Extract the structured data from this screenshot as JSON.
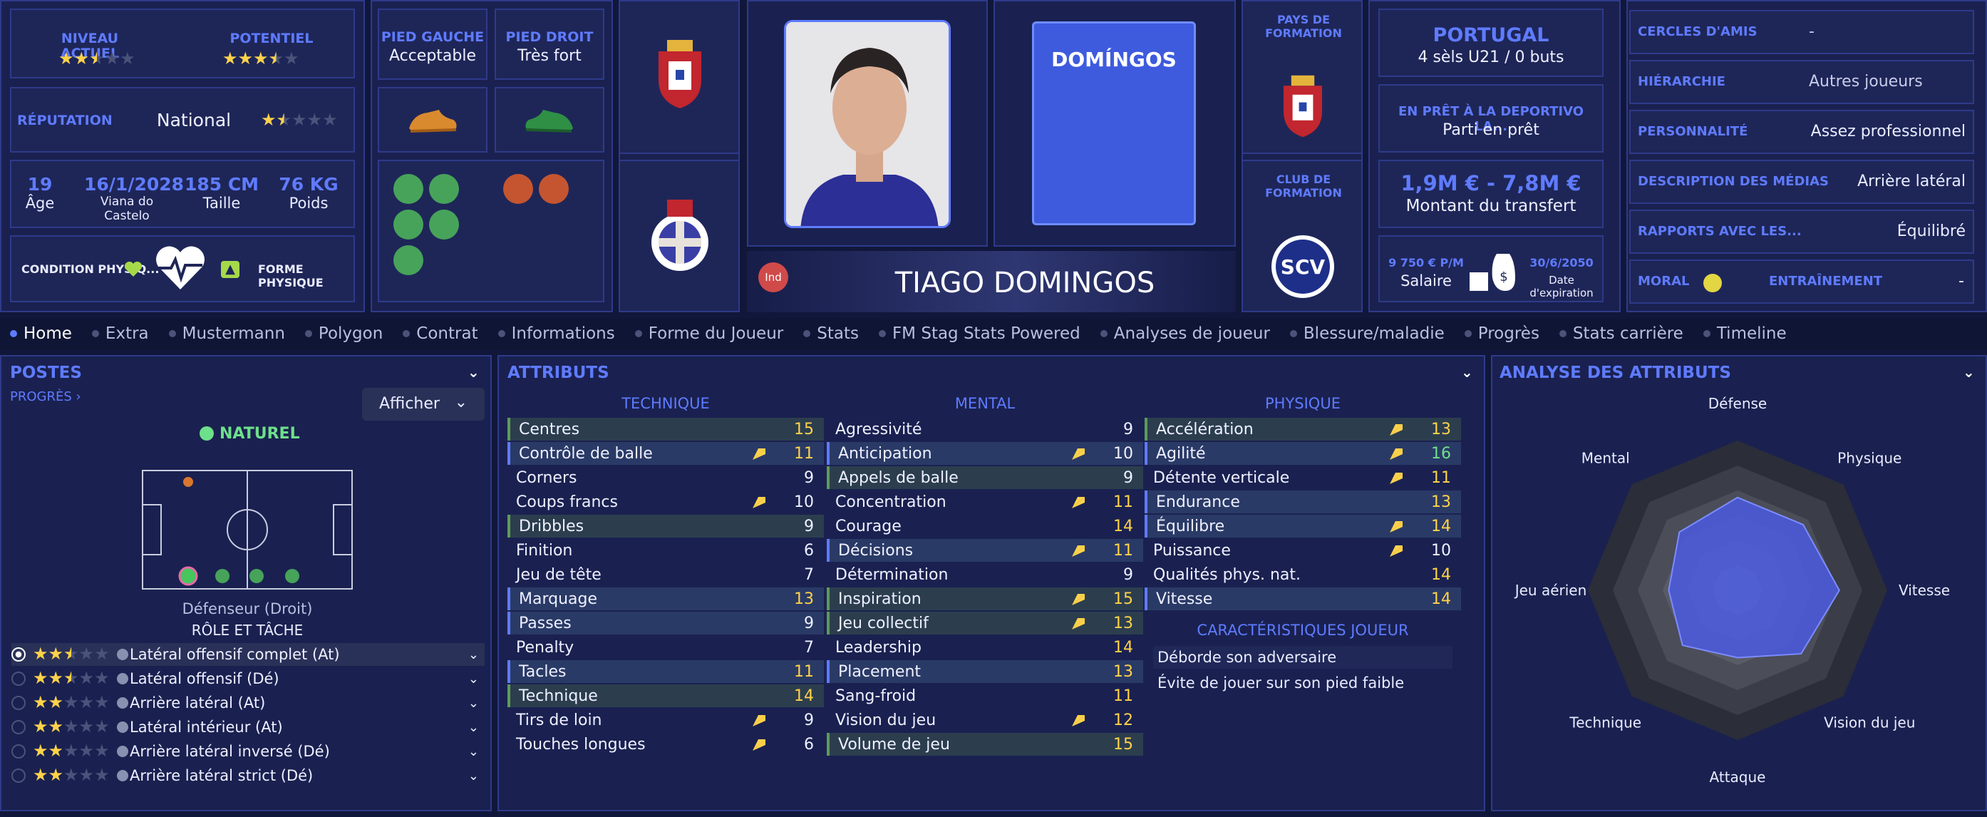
{
  "colors": {
    "accent": "#5f7bff",
    "star": "#ffd24a",
    "good": "#6de08a",
    "bg": "#11173a"
  },
  "top": {
    "current_level_label": "NIVEAU ACTUEL",
    "current_level_stars": 2.5,
    "potential_label": "POTENTIEL",
    "potential_stars": 3.5,
    "reputation_label": "RÉPUTATION",
    "reputation_value": "National",
    "reputation_stars": 1.5,
    "age": "19",
    "age_label": "Âge",
    "dob": "16/1/2028",
    "birthplace": "Viana do Castelo",
    "height": "185 CM",
    "height_label": "Taille",
    "weight": "76 KG",
    "weight_label": "Poids",
    "condition_label": "CONDITION PHYSIQ...",
    "form_label": "FORME PHYSIQUE",
    "left_foot_label": "PIED GAUCHE",
    "left_foot_value": "Acceptable",
    "right_foot_label": "PIED DROIT",
    "right_foot_value": "Très fort",
    "kit_name": "DOMÍNGOS",
    "player_name": "TIAGO DOMINGOS",
    "badge": "Ind",
    "nation_label": "PAYS DE FORMATION",
    "club_label": "CLUB DE FORMATION",
    "country": "PORTUGAL",
    "caps": "4 sèls U21 / 0 buts",
    "loan_label": "EN PRÊT À LA DEPORTIVO LA...",
    "loan_value": "Parti en prêt",
    "transfer_value": "1,9M € - 7,8M €",
    "transfer_label": "Montant du transfert",
    "salary": "9 750 € P/M",
    "salary_label": "Salaire",
    "expiry": "30/6/2050",
    "expiry_label": "Date d'expiration",
    "friends_label": "CERCLES D'AMIS",
    "friends_value": "-",
    "hierarchy_label": "HIÉRARCHIE",
    "hierarchy_value": "Autres joueurs",
    "personality_label": "PERSONNALITÉ",
    "personality_value": "Assez professionnel",
    "media_label": "DESCRIPTION DES MÉDIAS",
    "media_value": "Arrière latéral",
    "relations_label": "RAPPORTS AVEC LES...",
    "relations_value": "Équilibré",
    "morale_label": "MORAL",
    "training_label": "ENTRAÎNEMENT",
    "training_value": "-"
  },
  "tabs": [
    "Home",
    "Extra",
    "Mustermann",
    "Polygon",
    "Contrat",
    "Informations",
    "Forme du Joueur",
    "Stats",
    "FM Stag Stats Powered",
    "Analyses de joueur",
    "Blessure/maladie",
    "Progrès",
    "Stats carrière",
    "Timeline"
  ],
  "positions": {
    "title": "POSTES",
    "progress_link": "PROGRÈS",
    "show_button": "Afficher",
    "natural": "NATUREL",
    "position_name": "Défenseur (Droit)",
    "role_header": "RÔLE ET TÂCHE",
    "roles": [
      {
        "name": "Latéral offensif complet (At)",
        "stars": 2.5
      },
      {
        "name": "Latéral offensif (Dé)",
        "stars": 2.5
      },
      {
        "name": "Arrière latéral (At)",
        "stars": 2
      },
      {
        "name": "Latéral intérieur (At)",
        "stars": 2
      },
      {
        "name": "Arrière latéral inversé (Dé)",
        "stars": 2
      },
      {
        "name": "Arrière latéral strict (Dé)",
        "stars": 2
      }
    ]
  },
  "attributes": {
    "title": "ATTRIBUTS",
    "technical_header": "TECHNIQUE",
    "mental_header": "MENTAL",
    "physical_header": "PHYSIQUE",
    "technical": [
      {
        "name": "Centres",
        "value": "15",
        "hl": "g",
        "trend": false,
        "col": "y"
      },
      {
        "name": "Contrôle de balle",
        "value": "11",
        "hl": "b",
        "trend": true,
        "col": "y"
      },
      {
        "name": "Corners",
        "value": "9",
        "hl": "",
        "trend": false,
        "col": "w"
      },
      {
        "name": "Coups francs",
        "value": "10",
        "hl": "",
        "trend": true,
        "col": "w"
      },
      {
        "name": "Dribbles",
        "value": "9",
        "hl": "g",
        "trend": false,
        "col": "w"
      },
      {
        "name": "Finition",
        "value": "6",
        "hl": "",
        "trend": false,
        "col": "w"
      },
      {
        "name": "Jeu de tête",
        "value": "7",
        "hl": "",
        "trend": false,
        "col": "w"
      },
      {
        "name": "Marquage",
        "value": "13",
        "hl": "b",
        "trend": false,
        "col": "y"
      },
      {
        "name": "Passes",
        "value": "9",
        "hl": "b",
        "trend": false,
        "col": "w"
      },
      {
        "name": "Penalty",
        "value": "7",
        "hl": "",
        "trend": false,
        "col": "w"
      },
      {
        "name": "Tacles",
        "value": "11",
        "hl": "b",
        "trend": false,
        "col": "y"
      },
      {
        "name": "Technique",
        "value": "14",
        "hl": "g",
        "trend": false,
        "col": "y"
      },
      {
        "name": "Tirs de loin",
        "value": "9",
        "hl": "",
        "trend": true,
        "col": "w"
      },
      {
        "name": "Touches longues",
        "value": "6",
        "hl": "",
        "trend": true,
        "col": "w"
      }
    ],
    "mental": [
      {
        "name": "Agressivité",
        "value": "9",
        "hl": "",
        "trend": false,
        "col": "w"
      },
      {
        "name": "Anticipation",
        "value": "10",
        "hl": "b",
        "trend": true,
        "col": "w"
      },
      {
        "name": "Appels de balle",
        "value": "9",
        "hl": "g",
        "trend": false,
        "col": "w"
      },
      {
        "name": "Concentration",
        "value": "11",
        "hl": "",
        "trend": true,
        "col": "y"
      },
      {
        "name": "Courage",
        "value": "14",
        "hl": "",
        "trend": false,
        "col": "y"
      },
      {
        "name": "Décisions",
        "value": "11",
        "hl": "b",
        "trend": true,
        "col": "y"
      },
      {
        "name": "Détermination",
        "value": "9",
        "hl": "",
        "trend": false,
        "col": "w"
      },
      {
        "name": "Inspiration",
        "value": "15",
        "hl": "g",
        "trend": true,
        "col": "y"
      },
      {
        "name": "Jeu collectif",
        "value": "13",
        "hl": "g",
        "trend": true,
        "col": "y"
      },
      {
        "name": "Leadership",
        "value": "14",
        "hl": "",
        "trend": false,
        "col": "y"
      },
      {
        "name": "Placement",
        "value": "13",
        "hl": "b",
        "trend": false,
        "col": "y"
      },
      {
        "name": "Sang-froid",
        "value": "11",
        "hl": "",
        "trend": false,
        "col": "y"
      },
      {
        "name": "Vision du jeu",
        "value": "12",
        "hl": "",
        "trend": true,
        "col": "y"
      },
      {
        "name": "Volume de jeu",
        "value": "15",
        "hl": "g",
        "trend": false,
        "col": "y"
      }
    ],
    "physical": [
      {
        "name": "Accélération",
        "value": "13",
        "hl": "g",
        "trend": true,
        "col": "y"
      },
      {
        "name": "Agilité",
        "value": "16",
        "hl": "b",
        "trend": true,
        "col": "g"
      },
      {
        "name": "Détente verticale",
        "value": "11",
        "hl": "",
        "trend": true,
        "col": "y"
      },
      {
        "name": "Endurance",
        "value": "13",
        "hl": "b",
        "trend": false,
        "col": "y"
      },
      {
        "name": "Équilibre",
        "value": "14",
        "hl": "b",
        "trend": true,
        "col": "y"
      },
      {
        "name": "Puissance",
        "value": "10",
        "hl": "",
        "trend": true,
        "col": "w"
      },
      {
        "name": "Qualités phys. nat.",
        "value": "14",
        "hl": "",
        "trend": false,
        "col": "y"
      },
      {
        "name": "Vitesse",
        "value": "14",
        "hl": "b",
        "trend": false,
        "col": "y"
      }
    ],
    "traits_header": "CARACTÉRISTIQUES JOUEUR",
    "traits": [
      "Déborde son adversaire",
      "Évite de jouer sur son pied faible"
    ]
  },
  "analysis": {
    "title": "ANALYSE DES ATTRIBUTS",
    "axes": [
      "Défense",
      "Physique",
      "Vitesse",
      "Vision du jeu",
      "Attaque",
      "Technique",
      "Jeu aérien",
      "Mental"
    ],
    "values": [
      0.62,
      0.62,
      0.68,
      0.6,
      0.45,
      0.52,
      0.46,
      0.55
    ]
  }
}
